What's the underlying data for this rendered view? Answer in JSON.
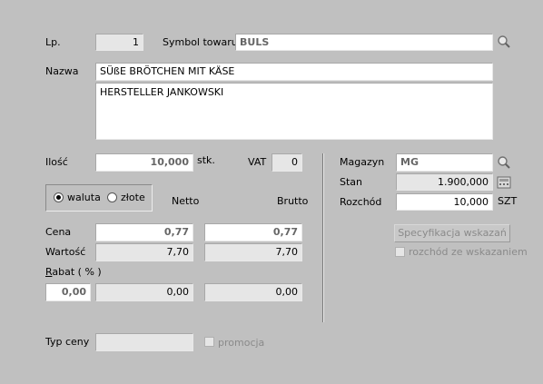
{
  "lp": {
    "label": "Lp.",
    "value": "1"
  },
  "symbol": {
    "label": "Symbol towaru",
    "value": "BULS"
  },
  "nazwa": {
    "label": "Nazwa",
    "value": "SÜßE BRÖTCHEN MIT KÄSE",
    "description": "HERSTELLER JANKOWSKI"
  },
  "ilosc": {
    "label": "Ilość",
    "value": "10,000",
    "unit": "stk."
  },
  "vat": {
    "label": "VAT",
    "value": "0"
  },
  "currency": {
    "option1": "waluta",
    "option2": "złote",
    "selected": "waluta"
  },
  "columns": {
    "netto": "Netto",
    "brutto": "Brutto"
  },
  "cena": {
    "label": "Cena",
    "netto": "0,77",
    "brutto": "0,77"
  },
  "wartosc": {
    "label": "Wartość",
    "netto": "7,70",
    "brutto": "7,70"
  },
  "rabat": {
    "label_u": "R",
    "label_rest": "abat ( % )",
    "percent": "0,00",
    "netto": "0,00",
    "brutto": "0,00"
  },
  "magazyn": {
    "label": "Magazyn",
    "value": "MG"
  },
  "stan": {
    "label": "Stan",
    "value": "1.900,000"
  },
  "rozchod": {
    "label": "Rozchód",
    "value": "10,000",
    "unit": "SZT"
  },
  "spec_button": "Specyfikacja wskazań",
  "rozchod_check": "rozchód ze wskazaniem",
  "typ_ceny": {
    "label": "Typ ceny",
    "value": ""
  },
  "promocja": "promocja",
  "icons": {
    "search": "magnifier-icon",
    "calc": "calculator-icon"
  }
}
